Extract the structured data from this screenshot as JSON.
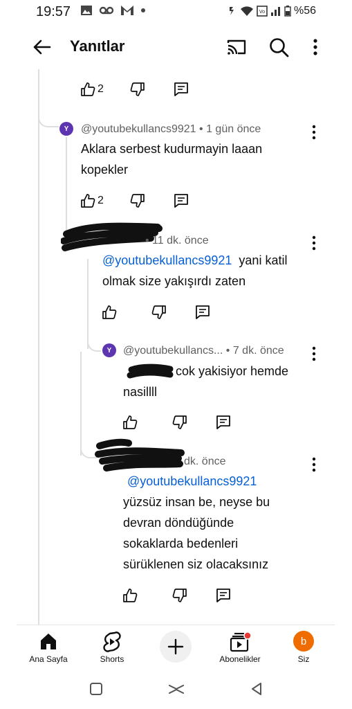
{
  "status_bar": {
    "time": "19:57",
    "battery": "%56",
    "left_icons": [
      "image-icon",
      "voicemail-icon",
      "gmail-icon",
      "dot-icon"
    ],
    "right_icons": [
      "alarm-icon",
      "wifi-icon",
      "volte-icon",
      "signal-icon",
      "battery-icon"
    ]
  },
  "app_bar": {
    "title": "Yanıtlar",
    "icons": [
      "back-arrow-icon",
      "cast-icon",
      "search-icon",
      "more-vert-icon"
    ]
  },
  "top_actions": {
    "like_count": "2"
  },
  "comments": [
    {
      "avatar_letter": "Y",
      "author": "@youtubekullancs9921",
      "time": "• 1 gün önce",
      "text": "Aklara serbest kudurmayin laaan kopekler",
      "like_count": "2"
    },
    {
      "author_redacted": true,
      "time": "• 11 dk. önce",
      "mention": "@youtubekullancs9921",
      "text": "yani katil olmak size yakışırdı zaten",
      "like_count": ""
    },
    {
      "avatar_letter": "Y",
      "author": "@youtubekullancs...",
      "time": "• 7 dk. önce",
      "mention_redacted": true,
      "text": "cok yakisiyor hemde nasillll",
      "like_count": ""
    },
    {
      "author_redacted": true,
      "time": "dk. önce",
      "mention": "@youtubekullancs9921",
      "text": "yüzsüz insan be, neyse bu devran döndüğünde sokaklarda bedenleri sürüklenen siz olacaksınız",
      "like_count": ""
    }
  ],
  "bottom_nav": {
    "items": [
      {
        "label": "Ana Sayfa",
        "icon": "home-icon"
      },
      {
        "label": "Shorts",
        "icon": "shorts-icon"
      },
      {
        "label": "",
        "icon": "create-plus-icon"
      },
      {
        "label": "Abonelikler",
        "icon": "subscriptions-icon"
      },
      {
        "label": "Siz",
        "icon": "account-avatar-icon",
        "avatar_letter": "b"
      }
    ]
  },
  "system_nav": [
    "recents-icon",
    "home-gesture-icon",
    "back-triangle-icon"
  ]
}
